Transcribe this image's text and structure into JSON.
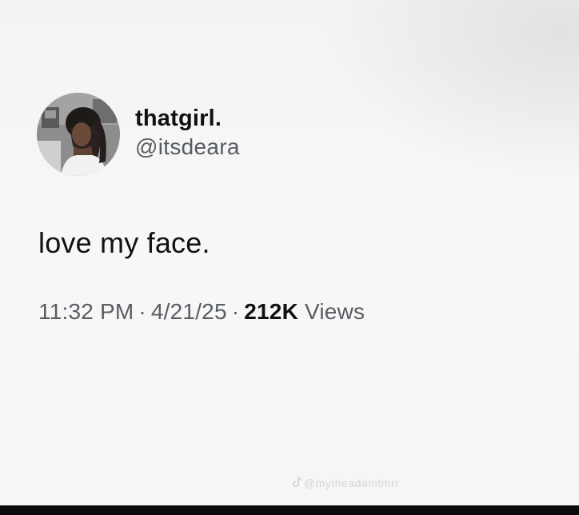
{
  "tweet": {
    "display_name": "thatgirl.",
    "handle": "@itsdeara",
    "text": "love my face.",
    "time": "11:32 PM",
    "date": "4/21/25",
    "views_count": "212K",
    "views_label": "Views",
    "separator": "·"
  },
  "watermark": {
    "icon": "tiktok-icon",
    "text": "@mytheadamtmrr"
  },
  "colors": {
    "background": "#f6f6f6",
    "text_primary": "#111111",
    "text_secondary": "#565b61",
    "bottom_bar": "#0a0a0a"
  }
}
